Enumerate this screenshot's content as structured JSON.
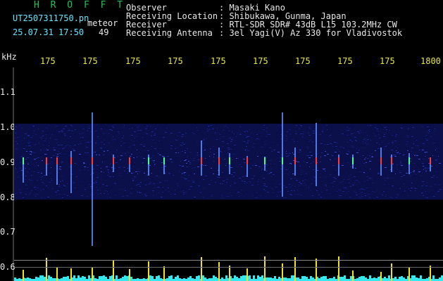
{
  "header": {
    "title": "H R O F F T",
    "file": "UT2507311750.pn",
    "meteor_label": "meteor",
    "date_time": "25.07.31 17:50",
    "count": "49"
  },
  "info": [
    {
      "label": "Observer",
      "value": ": Masaki Kano"
    },
    {
      "label": "Receiving Location",
      "value": ": Shibukawa, Gunma, Japan"
    },
    {
      "label": "Receiver",
      "value": ": RTL-SDR SDR# 43dB L15 103.2MHz CW"
    },
    {
      "label": "Receiving Antenna",
      "value": ": 3el Yagi(V) Az 330 for Vladivostok"
    }
  ],
  "axis": {
    "y_unit": "kHz",
    "y_ticks": [
      "1.1",
      "1.0",
      "0.9",
      "0.8",
      "0.7",
      "0.6"
    ],
    "x_ticks": [
      "175",
      "175",
      "175",
      "175",
      "175",
      "175",
      "175",
      "175",
      "175",
      "1800"
    ]
  },
  "colors": {
    "background": "#000000",
    "spectrogram_base": "#0b0f4a",
    "header_green": "#22c25a",
    "header_cyan": "#66e6ff",
    "tick_yellow": "#e8e64a",
    "amplitude_yellow": "#f2e21a",
    "amplitude_cyan": "#35e8f0"
  }
}
